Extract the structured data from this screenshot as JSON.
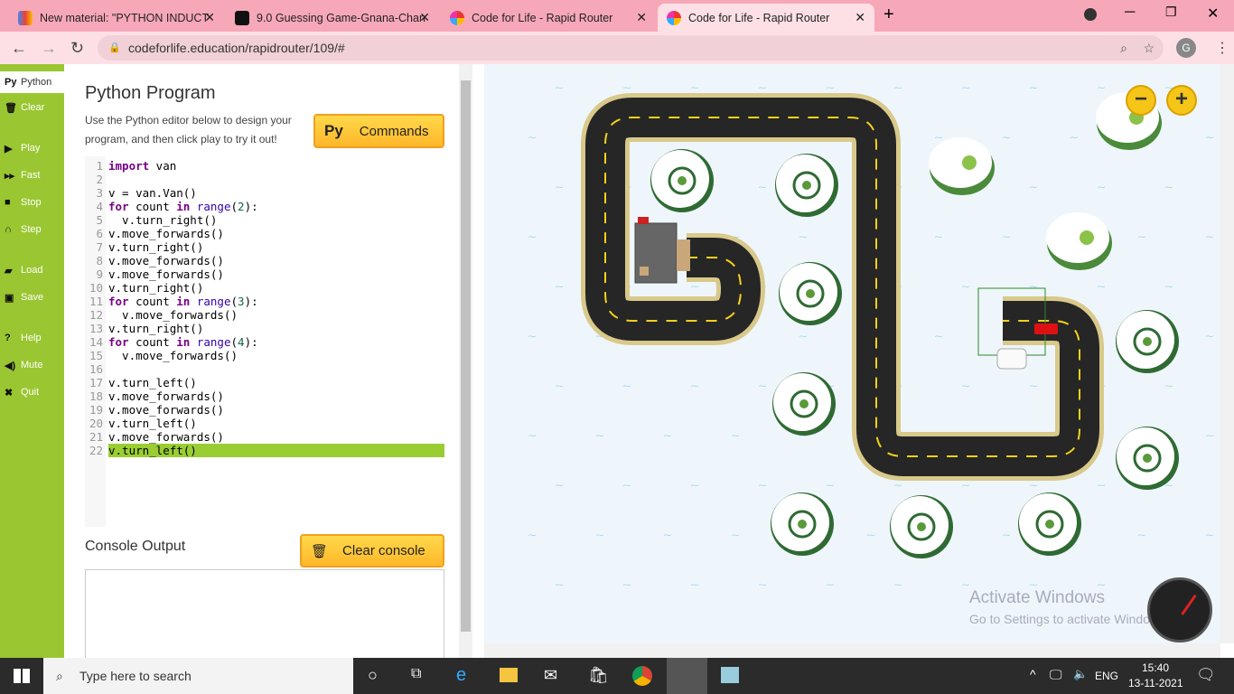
{
  "browser": {
    "tabs": [
      {
        "title": "New material: \"PYTHON INDUCT",
        "icon": "gmail-icon"
      },
      {
        "title": "9.0 Guessing Game-Gnana-Chan",
        "icon": "replit-icon"
      },
      {
        "title": "Code for Life - Rapid Router",
        "icon": "codeforlife-icon"
      },
      {
        "title": "Code for Life - Rapid Router",
        "icon": "codeforlife-icon",
        "active": true
      }
    ],
    "url": "codeforlife.education/rapidrouter/109/#",
    "profile": "G"
  },
  "sidebar": {
    "items": [
      {
        "label": "Python",
        "icon": "Py"
      },
      {
        "label": "Clear",
        "icon": "trash-icon"
      },
      {
        "label": "Play",
        "icon": "play-icon"
      },
      {
        "label": "Fast",
        "icon": "fast-forward-icon"
      },
      {
        "label": "Stop",
        "icon": "stop-icon"
      },
      {
        "label": "Step",
        "icon": "step-icon"
      },
      {
        "label": "Load",
        "icon": "folder-icon"
      },
      {
        "label": "Save",
        "icon": "save-icon"
      },
      {
        "label": "Help",
        "icon": "help-icon"
      },
      {
        "label": "Mute",
        "icon": "speaker-icon"
      },
      {
        "label": "Quit",
        "icon": "close-icon"
      }
    ]
  },
  "panel": {
    "title": "Python Program",
    "description": "Use the Python editor below to design your program, and then click play to try it out!",
    "commands_label": "Commands",
    "commands_icon": "Py",
    "console_title": "Console Output",
    "clear_console_label": "Clear console"
  },
  "code": [
    "import van",
    "",
    "v = van.Van()",
    "for count in range(2):",
    "  v.turn_right()",
    "v.move_forwards()",
    "v.turn_right()",
    "v.move_forwards()",
    "v.move_forwards()",
    "v.turn_right()",
    "for count in range(3):",
    "  v.move_forwards()",
    "v.turn_right()",
    "for count in range(4):",
    "  v.move_forwards()",
    "",
    "v.turn_left()",
    "v.move_forwards()",
    "v.move_forwards()",
    "v.turn_left()",
    "v.move_forwards()",
    "v.turn_left()"
  ],
  "highlighted_line": 22,
  "game": {
    "zoom_out": "−",
    "zoom_in": "+",
    "watermark_title": "Activate Windows",
    "watermark_sub": "Go to Settings to activate Windows."
  },
  "taskbar": {
    "search_placeholder": "Type here to search",
    "language": "ENG",
    "time": "15:40",
    "date": "13-11-2021"
  }
}
